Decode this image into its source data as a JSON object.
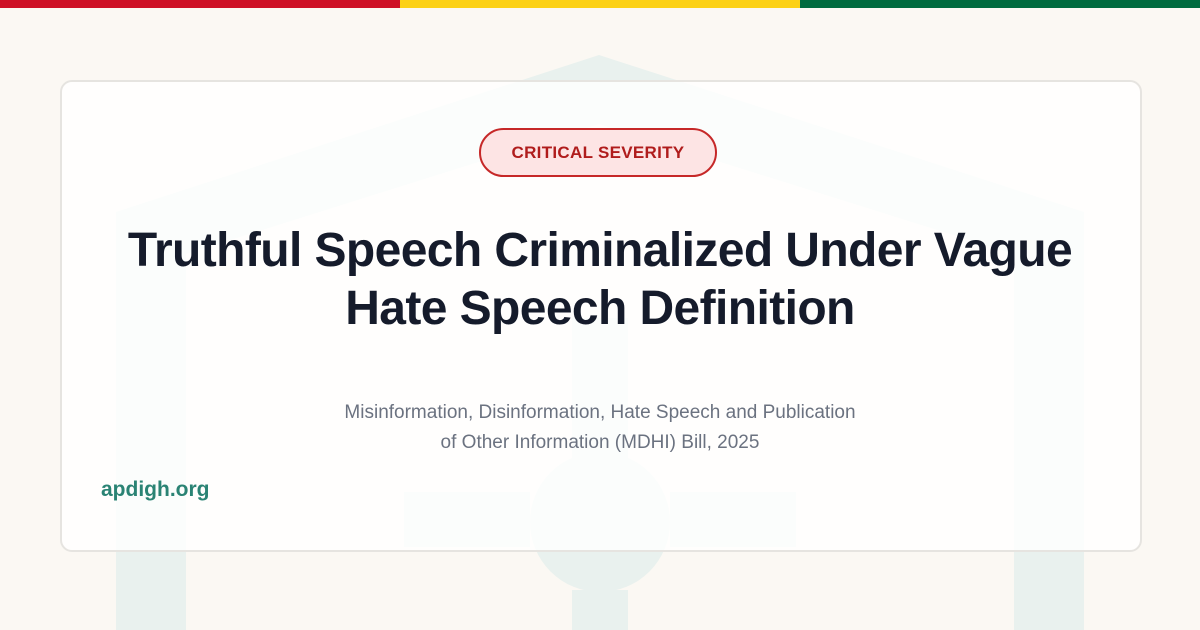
{
  "flag_colors": [
    "#ce1126",
    "#fcd116",
    "#006b3f"
  ],
  "background_color": "#fbf8f3",
  "watermark_color": "#e9f1ee",
  "badge": {
    "label": "CRITICAL SEVERITY",
    "border_color": "#c62828",
    "fill_color": "#fde4e4",
    "text_color": "#b01c1c"
  },
  "title": {
    "line1": "Truthful Speech Criminalized Under Vague",
    "line2": "Hate Speech Definition"
  },
  "subtitle": {
    "line1": "Misinformation, Disinformation, Hate Speech and Publication",
    "line2": "of Other Information (MDHI) Bill, 2025"
  },
  "site": {
    "label": "apdigh.org",
    "color": "#2a8374"
  }
}
